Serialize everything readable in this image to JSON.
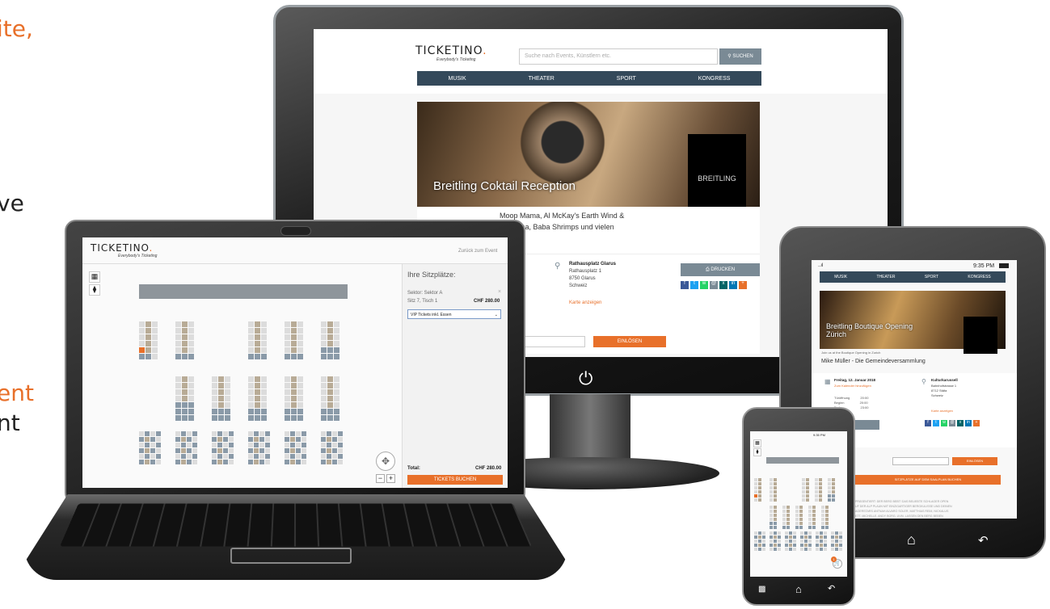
{
  "side_texts": {
    "t1": "ite,",
    "t2": "ve",
    "t3": "ent",
    "t4": "nt"
  },
  "monitor": {
    "logo": "TICKETINO",
    "logo_sub": "Everybody's Ticketing",
    "search_placeholder": "Suche nach Events, Künstlern etc.",
    "search_button": "SUCHEN",
    "nav": [
      "MUSIK",
      "THEATER",
      "SPORT",
      "KONGRESS"
    ],
    "hero_title": "Breitling Coktail Reception",
    "brand_logo": "BREITLING",
    "description_line1": "Moop Mama, Al McKay's Earth Wind &",
    "description_line2": "f Gemina, Baba Shrimps und vielen",
    "venue_name": "Rathausplatz Glarus",
    "venue_street": "Rathausplatz 1",
    "venue_city": "8750 Glarus",
    "venue_country": "Schweiz",
    "map_link": "Karte anzeigen",
    "print_button": "DRUCKEN",
    "redeem_button": "EINLÖSEN"
  },
  "laptop": {
    "logo": "TICKETINO",
    "logo_sub": "Everybody's Ticketing",
    "back_link": "Zurück zum Event",
    "panel_title": "Ihre Sitzplätze:",
    "sector": "Sektor: Sektor A",
    "seat": "Sitz 7, Tisch 1",
    "price": "CHF 280.00",
    "ticket_type": "VIP Tickets inkl. Essen",
    "total_label": "Total:",
    "total_value": "CHF 280.00",
    "book_button": "TICKETS BUCHEN"
  },
  "tablet": {
    "time": "9:35 PM",
    "signal": "..ıl",
    "nav": [
      "MUSIK",
      "THEATER",
      "SPORT",
      "KONGRESS"
    ],
    "hero_title": "Breitling Boutique Opening Zürich",
    "caption": "Join us at the Boutique Opening in Zurich",
    "event_title": "Mike Müller - Die Gemeindeversammlung",
    "date": "Freitag, 12. Januar 2018",
    "calendar_link": "Zum Kalender hinzufügen",
    "times": [
      [
        "Türöffnung",
        "20:00"
      ],
      [
        "Beginn",
        "20:00"
      ],
      [
        "Ende",
        "23:00"
      ]
    ],
    "venue_name": "Kulturkarussell",
    "venue_street": "Bahnhofstrasse 1",
    "venue_city": "8712 Stäfa",
    "venue_country": "Schweiz",
    "map_link": "Karte anzeigen",
    "redeem_button": "EINLÖSEN",
    "seatplan_button": "SITZPLÄTZE AUF DEM SAALPLAN BUCHEN",
    "body_line1": "PRÄSENTIERT: DER BERG BEBT! DAS BELIEBTE SCHLAGER OPEN",
    "body_line2": "UF DER ALP PLAUN MIT EINZIGARTIGER BERGKULISSE UND DEINEN",
    "body_line3": "AGERSTARS ANTNAH ALVARO SOLER, MATTHIAS REIM, NICKALUS",
    "body_line4": "ETT, MICHELLE, ANDY BORG, UVM. LASSEN DEN BERG BEBEN"
  },
  "phone": {
    "time": "9:35 PM",
    "cart_count": "1"
  },
  "colors": {
    "accent": "#e8702a",
    "nav": "#34495a",
    "seat_taken": "#8a9aa8",
    "seat_free": "#b8ab96",
    "seat_selected": "#e8702a"
  }
}
